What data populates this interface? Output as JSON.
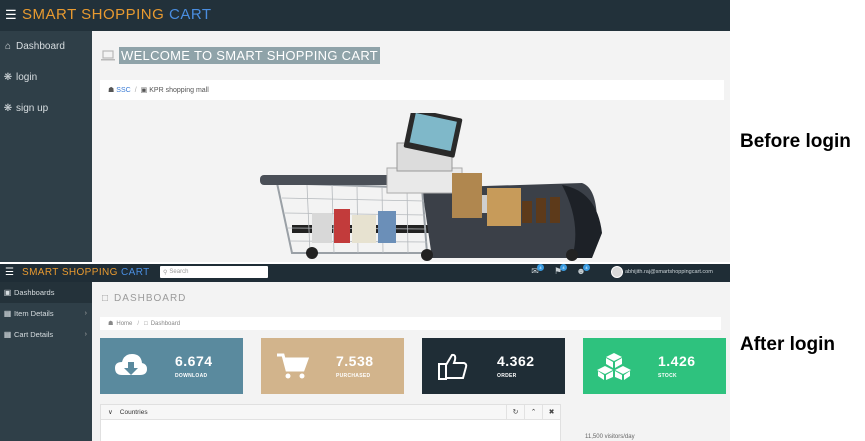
{
  "before_login": {
    "brand": {
      "part1": "SMART SHOPPING",
      "part2": "CART"
    },
    "menu_icon": "hamburger-icon",
    "sidebar": {
      "items": [
        {
          "label": "Dashboard",
          "icon": "home-icon"
        },
        {
          "label": "login",
          "icon": "gear-icon"
        },
        {
          "label": "sign up",
          "icon": "gear-icon"
        }
      ]
    },
    "page_title": "WELCOME TO SMART SHOPPING CART",
    "page_title_icon": "laptop-icon",
    "breadcrumb": {
      "home": "SSC",
      "current": "KPR shopping mall"
    },
    "hero_image": "shopping-cart-with-tablet"
  },
  "after_login": {
    "brand": {
      "part1": "SMART SHOPPING",
      "part2": "CART"
    },
    "search": {
      "placeholder": "Search"
    },
    "header_icons": [
      {
        "name": "envelope-icon",
        "badge": "4"
      },
      {
        "name": "flag-icon",
        "badge": "4"
      },
      {
        "name": "users-icon",
        "badge": "4"
      }
    ],
    "user": {
      "email": "abhijith.raj@smartshoppingcart.com"
    },
    "sidebar": {
      "items": [
        {
          "label": "Dashboards",
          "icon": "dashboard-icon"
        },
        {
          "label": "Item Details",
          "icon": "table-icon"
        },
        {
          "label": "Cart Details",
          "icon": "table-icon"
        }
      ]
    },
    "page_title": "DASHBOARD",
    "breadcrumb": {
      "home": "Home",
      "current": "Dashboard"
    },
    "stat_cards": [
      {
        "value": "6.674",
        "label": "DOWNLOAD",
        "color": "#5a8a9e",
        "icon": "cloud-download-icon"
      },
      {
        "value": "7.538",
        "label": "PURCHASED",
        "color": "#d2b48c",
        "icon": "cart-icon"
      },
      {
        "value": "4.362",
        "label": "ORDER",
        "color": "#1f2d36",
        "icon": "thumbs-up-icon"
      },
      {
        "value": "1.426",
        "label": "STOCK",
        "color": "#2ec27e",
        "icon": "cubes-icon"
      }
    ],
    "countries_widget": {
      "title": "Countries"
    },
    "right_note": "11,500 visitors/day"
  },
  "labels": {
    "before": "Before login",
    "after": "After login"
  }
}
